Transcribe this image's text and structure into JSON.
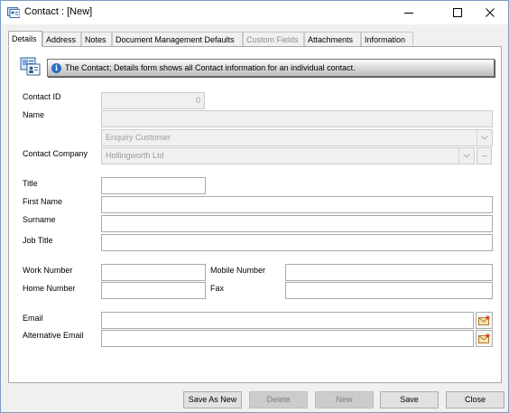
{
  "window": {
    "title": "Contact : [New]"
  },
  "tabs": [
    {
      "label": "Details",
      "state": "active"
    },
    {
      "label": "Address",
      "state": "normal"
    },
    {
      "label": "Notes",
      "state": "normal"
    },
    {
      "label": "Document Management Defaults",
      "state": "normal"
    },
    {
      "label": "Custom Fields",
      "state": "disabled"
    },
    {
      "label": "Attachments",
      "state": "normal"
    },
    {
      "label": "Information",
      "state": "normal"
    }
  ],
  "info": {
    "message": "The Contact; Details form shows all Contact information for an individual contact."
  },
  "form": {
    "contact_id_label": "Contact ID",
    "contact_id_value": "0",
    "name_label": "Name",
    "name_value": "",
    "customer_type_value": "Enquiry Customer",
    "contact_company_label": "Contact Company",
    "contact_company_value": "Hollingworth Ltd",
    "ellipsis_label": "...",
    "title_label": "Title",
    "first_name_label": "First Name",
    "surname_label": "Surname",
    "job_title_label": "Job Title",
    "work_number_label": "Work Number",
    "mobile_number_label": "Mobile Number",
    "home_number_label": "Home Number",
    "fax_label": "Fax",
    "email_label": "Email",
    "alt_email_label": "Alternative Email"
  },
  "buttons": {
    "save_as_new": "Save As New",
    "delete": "Delete",
    "new": "New",
    "save": "Save",
    "close": "Close"
  }
}
